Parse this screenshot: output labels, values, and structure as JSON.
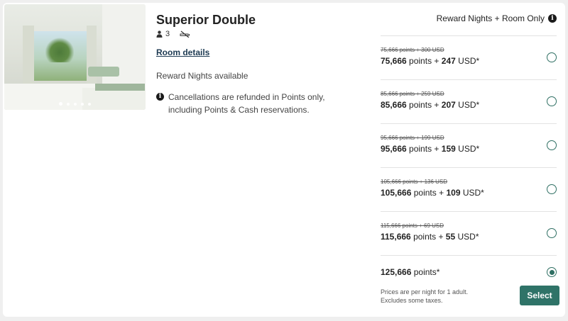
{
  "room": {
    "title": "Superior Double",
    "guests": "3",
    "details_link": "Room details",
    "availability": "Reward Nights available",
    "cancellation": "Cancellations are refunded in Points only, including Points & Cash reservations."
  },
  "header": {
    "rate_type": "Reward Nights + Room Only"
  },
  "gallery": {
    "dot_count": 5,
    "active_index": 0
  },
  "rates": [
    {
      "old": "75,666 points + 300 USD",
      "points": "75,666",
      "pts_label": "points",
      "plus": "+",
      "cash": "247",
      "currency": "USD*",
      "selected": false
    },
    {
      "old": "85,666 points + 259 USD",
      "points": "85,666",
      "pts_label": "points",
      "plus": "+",
      "cash": "207",
      "currency": "USD*",
      "selected": false
    },
    {
      "old": "95,666 points + 199 USD",
      "points": "95,666",
      "pts_label": "points",
      "plus": "+",
      "cash": "159",
      "currency": "USD*",
      "selected": false
    },
    {
      "old": "105,666 points + 136 USD",
      "points": "105,666",
      "pts_label": "points",
      "plus": "+",
      "cash": "109",
      "currency": "USD*",
      "selected": false
    },
    {
      "old": "115,666 points + 69 USD",
      "points": "115,666",
      "pts_label": "points",
      "plus": "+",
      "cash": "55",
      "currency": "USD*",
      "selected": false
    }
  ],
  "final_rate": {
    "points": "125,666",
    "pts_label": "points*",
    "selected": true
  },
  "footer": {
    "note_line1": "Prices are per night for 1 adult.",
    "note_line2": "Excludes some taxes.",
    "select_label": "Select"
  },
  "colors": {
    "accent": "#2f7368",
    "link": "#1d3a52"
  }
}
